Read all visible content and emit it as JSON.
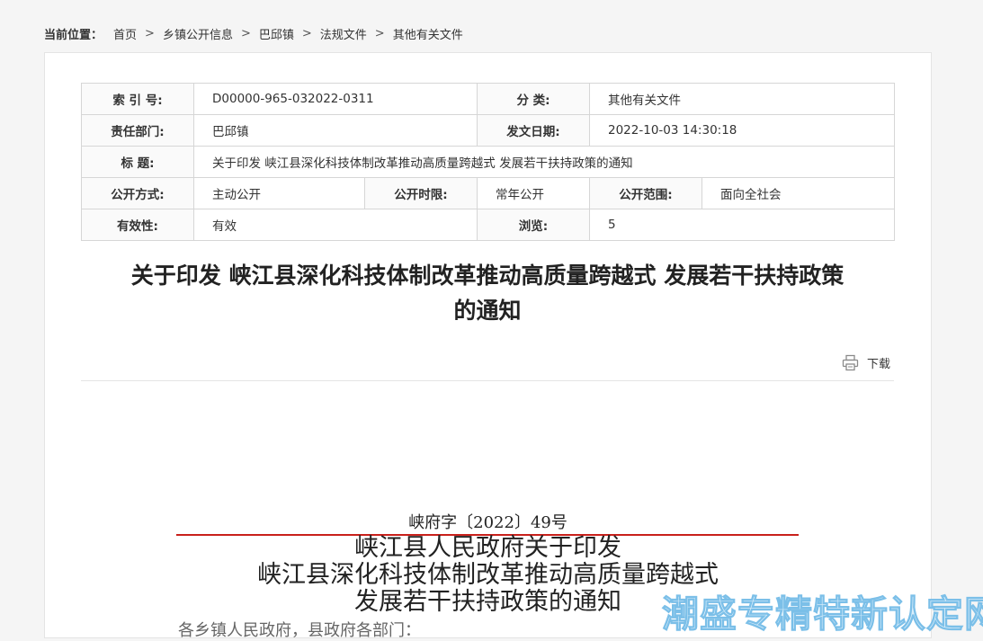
{
  "breadcrumb": {
    "label": "当前位置：",
    "items": [
      "首页",
      "乡镇公开信息",
      "巴邱镇",
      "法规文件",
      "其他有关文件"
    ],
    "separator": ">"
  },
  "meta": {
    "index_label": "索 引 号:",
    "index_value": "D00000-965-032022-0311",
    "category_label": "分 类:",
    "category_value": "其他有关文件",
    "dept_label": "责任部门:",
    "dept_value": "巴邱镇",
    "date_label": "发文日期:",
    "date_value": "2022-10-03 14:30:18",
    "title_label": "标 题:",
    "title_value": "关于印发 峡江县深化科技体制改革推动高质量跨越式 发展若干扶持政策的通知",
    "method_label": "公开方式:",
    "method_value": "主动公开",
    "period_label": "公开时限:",
    "period_value": "常年公开",
    "scope_label": "公开范围:",
    "scope_value": "面向全社会",
    "validity_label": "有效性:",
    "validity_value": "有效",
    "views_label": "浏览:",
    "views_value": "5"
  },
  "article": {
    "title_line1": "关于印发  峡江县深化科技体制改革推动高质量跨越式  发展若干扶持政策",
    "title_line2": "的通知",
    "download_label": "下载"
  },
  "document": {
    "number": "峡府字〔2022〕49号",
    "heading_line1": "峡江县人民政府关于印发",
    "heading_line2": "峡江县深化科技体制改革推动高质量跨越式",
    "heading_line3": "发展若干扶持政策的通知",
    "cut_line": "各乡镇人民政府，县政府各部门："
  },
  "watermark": "潮盛专精特新认定网",
  "colors": {
    "red_rule": "#c9201b",
    "watermark_fill": "#d9eefb",
    "watermark_stroke": "#7bbfe8"
  },
  "icons": {
    "download": "printer-icon"
  }
}
